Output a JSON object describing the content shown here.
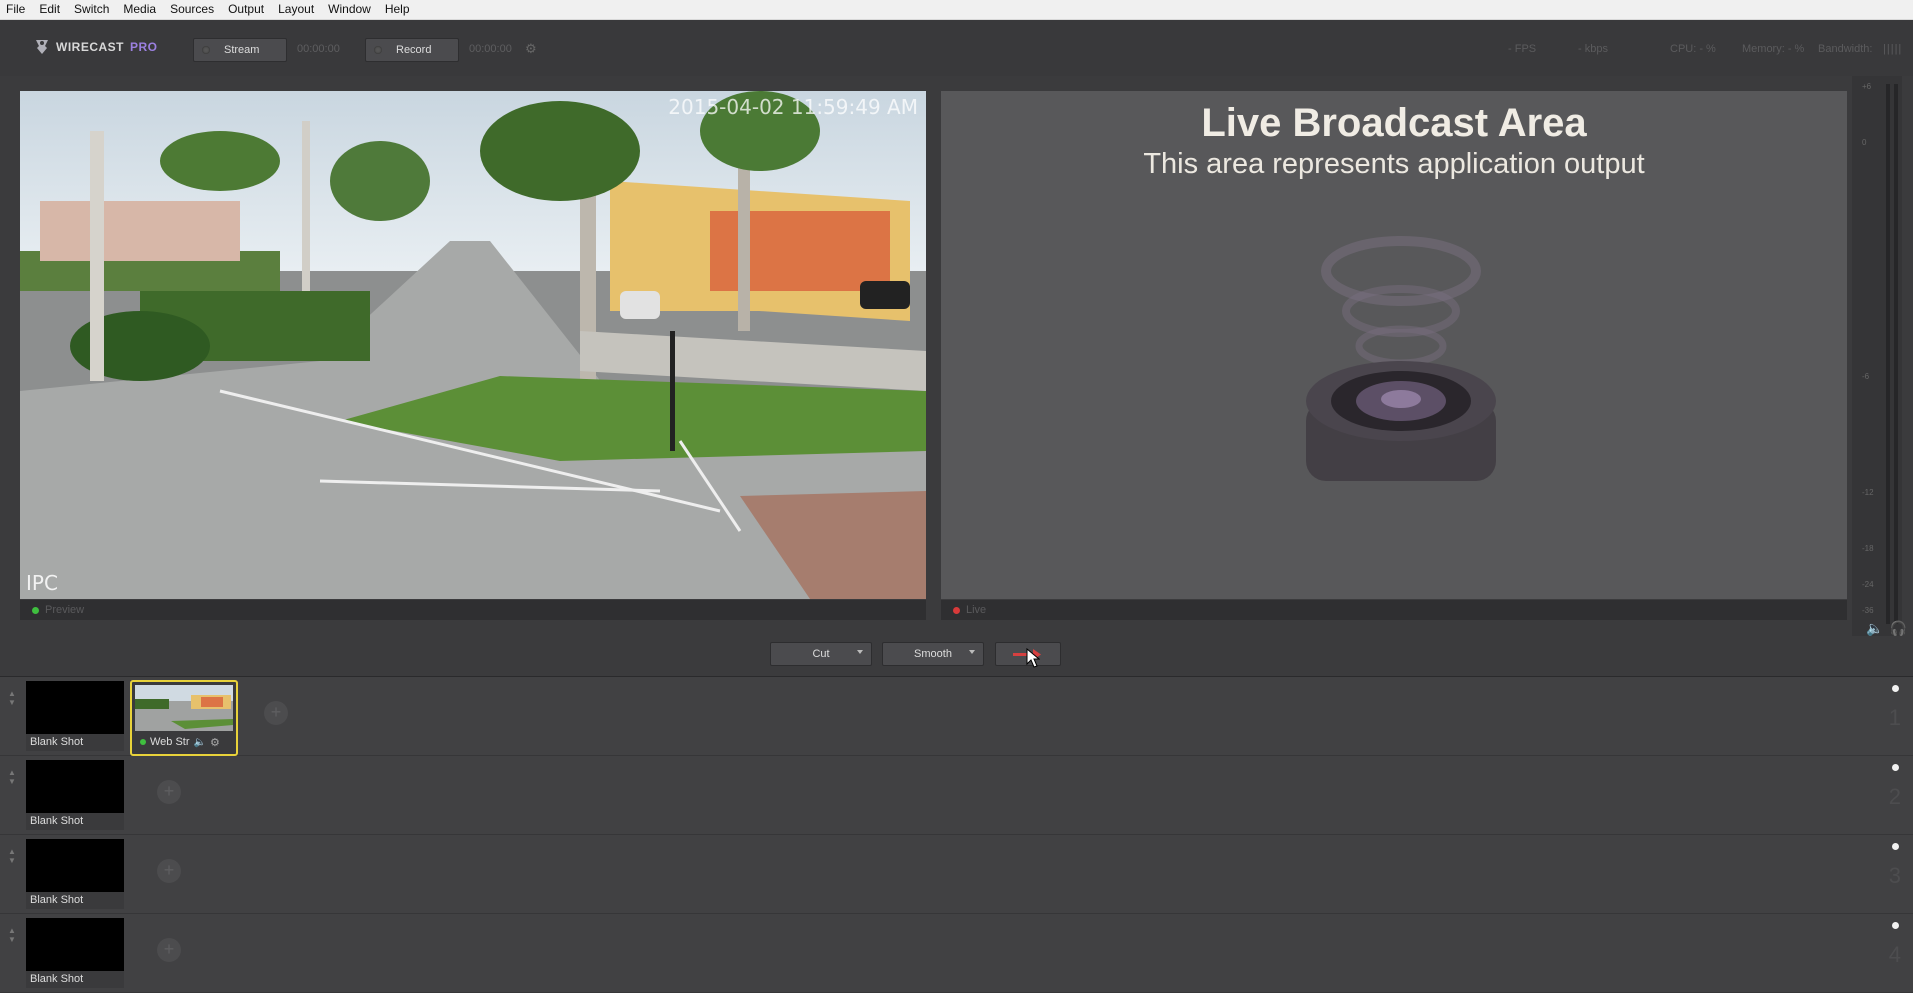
{
  "menu": [
    "File",
    "Edit",
    "Switch",
    "Media",
    "Sources",
    "Output",
    "Layout",
    "Window",
    "Help"
  ],
  "toolbar": {
    "brand": "WIRECAST",
    "brand_edition": "PRO",
    "stream_label": "Stream",
    "stream_time": "00:00:00",
    "record_label": "Record",
    "record_time": "00:00:00"
  },
  "stats": {
    "fps": "- FPS",
    "kbps": "- kbps",
    "cpu": "CPU: - %",
    "memory": "Memory: - %",
    "bandwidth": "Bandwidth:"
  },
  "preview": {
    "timestamp": "2015-04-02 11:59:49 AM",
    "overlay": "IPC",
    "footer_label": "Preview",
    "led_color": "#3fbf3f"
  },
  "live": {
    "title": "Live Broadcast Area",
    "subtitle": "This area represents application output",
    "footer_label": "Live",
    "led_color": "#d83a3a"
  },
  "vu_meter": {
    "ticks": [
      "+6",
      "0",
      "-6",
      "-12",
      "-18",
      "-24",
      "-36"
    ]
  },
  "transitions": {
    "first": "Cut",
    "second": "Smooth"
  },
  "layers": [
    {
      "number": "1",
      "shots": [
        {
          "label": "Blank Shot"
        }
      ],
      "selected_shot": {
        "label": "Web Str"
      }
    },
    {
      "number": "2",
      "shots": [
        {
          "label": "Blank Shot"
        }
      ]
    },
    {
      "number": "3",
      "shots": [
        {
          "label": "Blank Shot"
        }
      ]
    },
    {
      "number": "4",
      "shots": [
        {
          "label": "Blank Shot"
        }
      ]
    }
  ],
  "colors": {
    "accent": "#9b80e0",
    "selected_border": "#e8d23a",
    "background": "#3b3b3d"
  }
}
